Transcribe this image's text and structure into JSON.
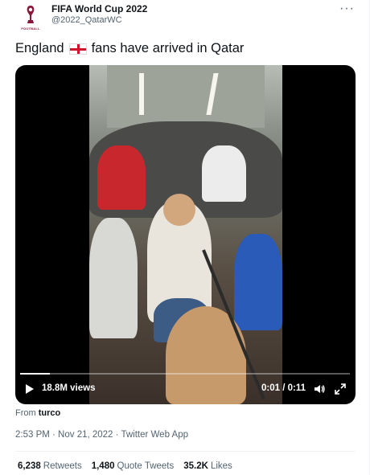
{
  "author": {
    "name": "FIFA World Cup 2022",
    "handle": "@2022_QatarWC",
    "avatar_text": "FOOTBALL",
    "avatar_icon": "world-cup-trophy-logo"
  },
  "more_icon": "more-horizontal-icon",
  "tweet": {
    "text_before": "England",
    "flag": "england-flag-emoji",
    "text_after": "fans have arrived in Qatar"
  },
  "video": {
    "views": "18.8M views",
    "time": "0:01 / 0:11",
    "progress_fraction": 0.09,
    "play_icon": "play-icon",
    "volume_icon": "volume-icon",
    "fullscreen_icon": "fullscreen-icon"
  },
  "source": {
    "prefix": "From",
    "name": "turco"
  },
  "meta": {
    "timestamp": "2:53 PM · Nov 21, 2022 · Twitter Web App"
  },
  "stats": [
    {
      "count": "6,238",
      "label": "Retweets"
    },
    {
      "count": "1,480",
      "label": "Quote Tweets"
    },
    {
      "count": "35.2K",
      "label": "Likes"
    }
  ],
  "colors": {
    "text": "#0f1419",
    "secondary": "#536471",
    "divider": "#eff3f4",
    "video_bg": "#000000"
  }
}
